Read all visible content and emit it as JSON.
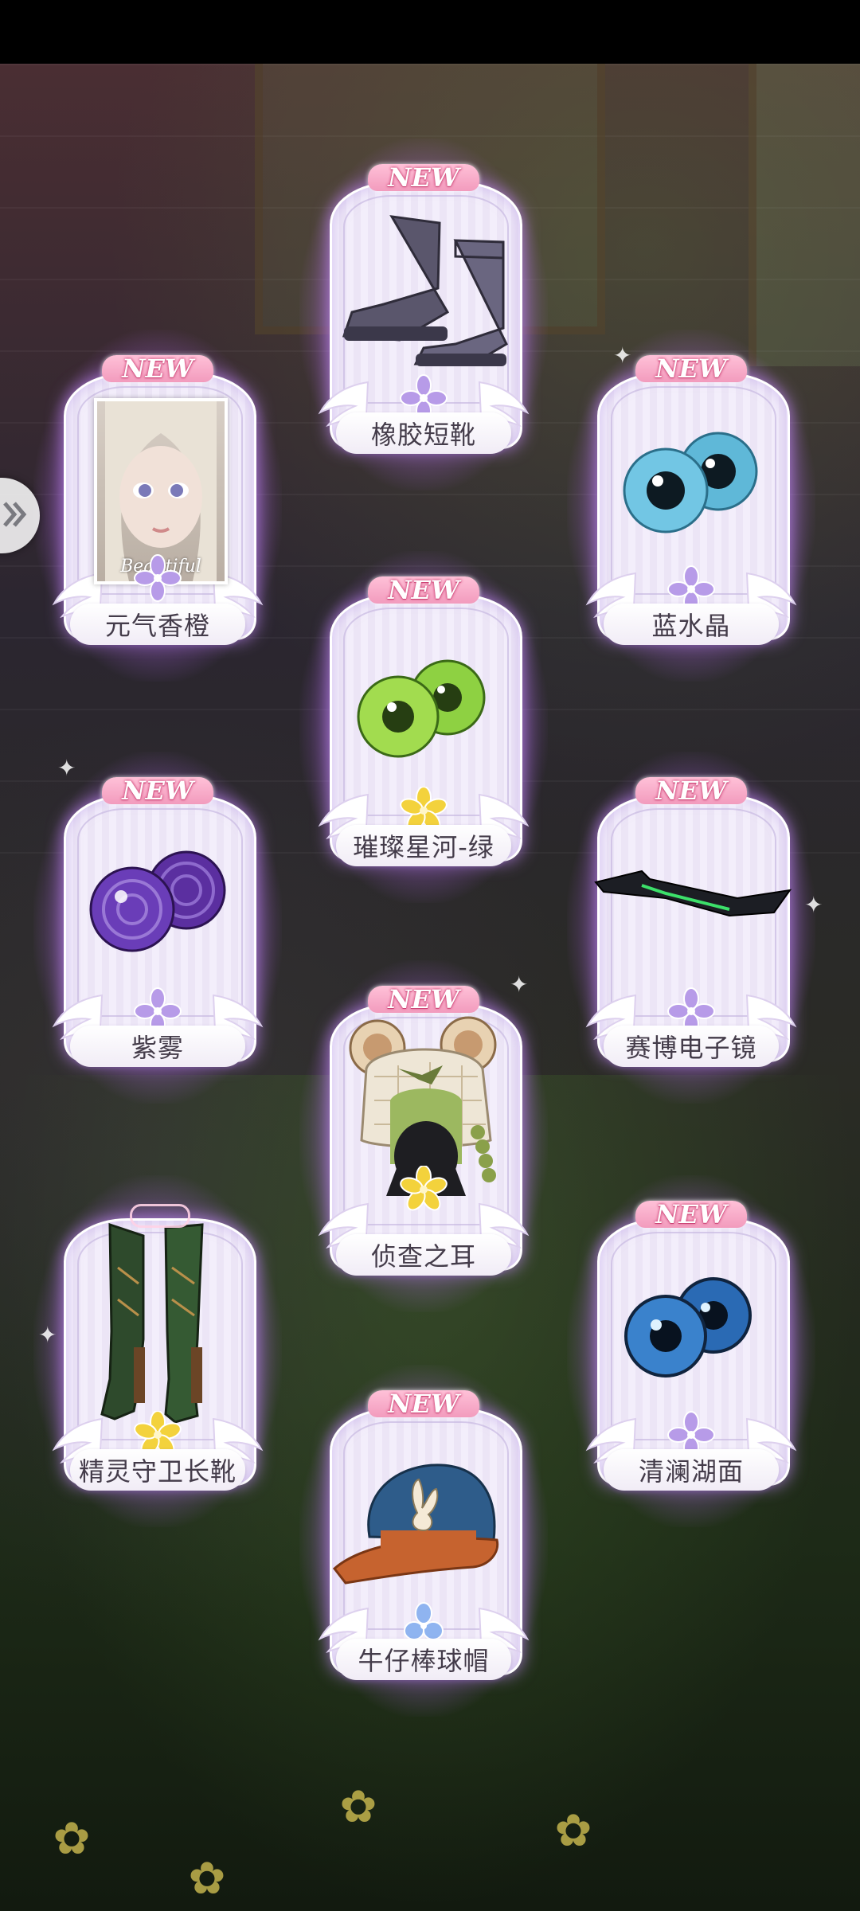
{
  "navigation": {
    "side_arrow_icon": "double-chevron-right-icon"
  },
  "new_badge_text": "NEW",
  "portrait_caption": "Beautiful",
  "colors": {
    "glow": "#b46cff",
    "card_bg": "#f3eefb",
    "new_badge": "#f29bbd",
    "rarity_purple": "#b79be8",
    "rarity_gold": "#f3d23c",
    "rarity_blue": "#8fb4f0"
  },
  "items": [
    {
      "name": "橡胶短靴",
      "is_new": true,
      "rarity_icon": "purple-flower-icon",
      "item_icon": "rubber-boots-icon"
    },
    {
      "name": "元气香橙",
      "is_new": true,
      "rarity_icon": "purple-flower-icon",
      "item_icon": "makeup-portrait-icon"
    },
    {
      "name": "蓝水晶",
      "is_new": true,
      "rarity_icon": "purple-flower-icon",
      "item_icon": "blue-eyes-icon"
    },
    {
      "name": "璀璨星河-绿",
      "is_new": true,
      "rarity_icon": "gold-star-flower-icon",
      "item_icon": "green-eyes-icon"
    },
    {
      "name": "紫雾",
      "is_new": true,
      "rarity_icon": "purple-flower-icon",
      "item_icon": "purple-eyes-icon"
    },
    {
      "name": "赛博电子镜",
      "is_new": true,
      "rarity_icon": "purple-flower-icon",
      "item_icon": "cyber-visor-icon"
    },
    {
      "name": "侦查之耳",
      "is_new": true,
      "rarity_icon": "gold-star-flower-icon",
      "item_icon": "bear-ear-hood-icon"
    },
    {
      "name": "精灵守卫长靴",
      "is_new": false,
      "rarity_icon": "gold-star-flower-icon",
      "item_icon": "elf-long-boots-icon"
    },
    {
      "name": "清澜湖面",
      "is_new": true,
      "rarity_icon": "purple-flower-icon",
      "item_icon": "blue-lake-eyes-icon"
    },
    {
      "name": "牛仔棒球帽",
      "is_new": true,
      "rarity_icon": "blue-flower-icon",
      "item_icon": "denim-cap-icon"
    }
  ]
}
